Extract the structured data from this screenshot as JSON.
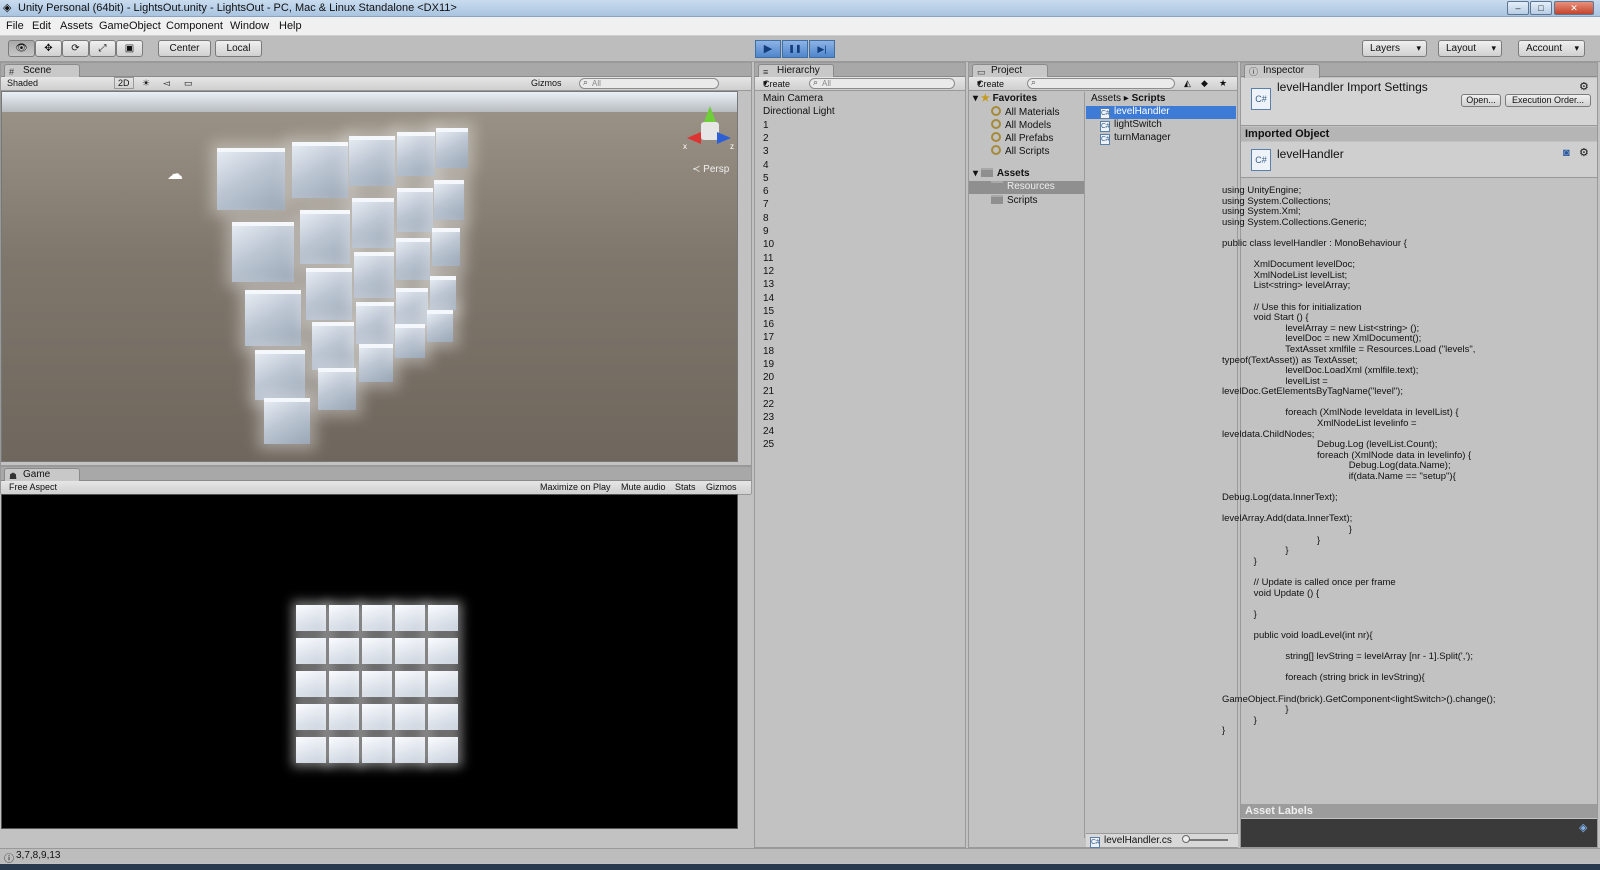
{
  "window": {
    "title": "Unity Personal (64bit) - LightsOut.unity - LightsOut - PC, Mac & Linux Standalone <DX11>",
    "min": "–",
    "max": "□",
    "close": "✕"
  },
  "menu": [
    "File",
    "Edit",
    "Assets",
    "GameObject",
    "Component",
    "Window",
    "Help"
  ],
  "toolbar": {
    "tools": [
      "👁",
      "✥",
      "⟳",
      "⤢",
      "▣"
    ],
    "center": "Center",
    "local": "Local",
    "play": "▶",
    "pause": "❚❚",
    "step": "▶|",
    "layers": "Layers",
    "layout": "Layout",
    "account": "Account"
  },
  "scene": {
    "tab": "Scene",
    "shading": "Shaded",
    "mode2d": "2D",
    "gizmos": "Gizmos",
    "search": "All",
    "persp": "Persp",
    "axis_x": "x",
    "axis_z": "z"
  },
  "game": {
    "tab": "Game",
    "aspect": "Free Aspect",
    "maximize": "Maximize on Play",
    "mute": "Mute audio",
    "stats": "Stats",
    "gizmos": "Gizmos"
  },
  "hierarchy": {
    "tab": "Hierarchy",
    "create": "Create",
    "search": "All",
    "items": [
      "Main Camera",
      "Directional Light",
      "1",
      "2",
      "3",
      "4",
      "5",
      "6",
      "7",
      "8",
      "9",
      "10",
      "11",
      "12",
      "13",
      "14",
      "15",
      "16",
      "17",
      "18",
      "19",
      "20",
      "21",
      "22",
      "23",
      "24",
      "25"
    ]
  },
  "project": {
    "tab": "Project",
    "create": "Create",
    "favorites_label": "Favorites",
    "favorites": [
      "All Materials",
      "All Models",
      "All Prefabs",
      "All Scripts"
    ],
    "assets_label": "Assets",
    "folders": [
      "Resources",
      "Scripts"
    ],
    "breadcrumb_root": "Assets",
    "breadcrumb_current": "Scripts",
    "files": [
      "levelHandler",
      "lightSwitch",
      "turnManager"
    ],
    "selected_file": "levelHandler.cs"
  },
  "inspector": {
    "tab": "Inspector",
    "title": "levelHandler Import Settings",
    "open": "Open...",
    "exec_order": "Execution Order...",
    "imported_object": "Imported Object",
    "object_name": "levelHandler",
    "asset_labels": "Asset Labels",
    "code": "using UnityEngine;\nusing System.Collections;\nusing System.Xml;\nusing System.Collections.Generic;\n\npublic class levelHandler : MonoBehaviour {\n\n            XmlDocument levelDoc;\n            XmlNodeList levelList;\n            List<string> levelArray;\n\n            // Use this for initialization\n            void Start () {\n                        levelArray = new List<string> ();\n                        levelDoc = new XmlDocument();\n                        TextAsset xmlfile = Resources.Load (\"levels\",\ntypeof(TextAsset)) as TextAsset;\n                        levelDoc.LoadXml (xmlfile.text);\n                        levelList =\nlevelDoc.GetElementsByTagName(\"level\");\n\n                        foreach (XmlNode leveldata in levelList) {\n                                    XmlNodeList levelinfo =\nleveldata.ChildNodes;\n                                    Debug.Log (levelList.Count);\n                                    foreach (XmlNode data in levelinfo) {\n                                                Debug.Log(data.Name);\n                                                if(data.Name == \"setup\"){\n\nDebug.Log(data.InnerText);\n\nlevelArray.Add(data.InnerText);\n                                                }\n                                    }\n                        }\n            }\n\n            // Update is called once per frame\n            void Update () {\n\n            }\n\n            public void loadLevel(int nr){\n\n                        string[] levString = levelArray [nr - 1].Split(',');\n\n                        foreach (string brick in levString){\n\nGameObject.Find(brick).GetComponent<lightSwitch>().change();\n                        }\n            }\n}"
  },
  "status": {
    "message": "3,7,8,9,13"
  }
}
